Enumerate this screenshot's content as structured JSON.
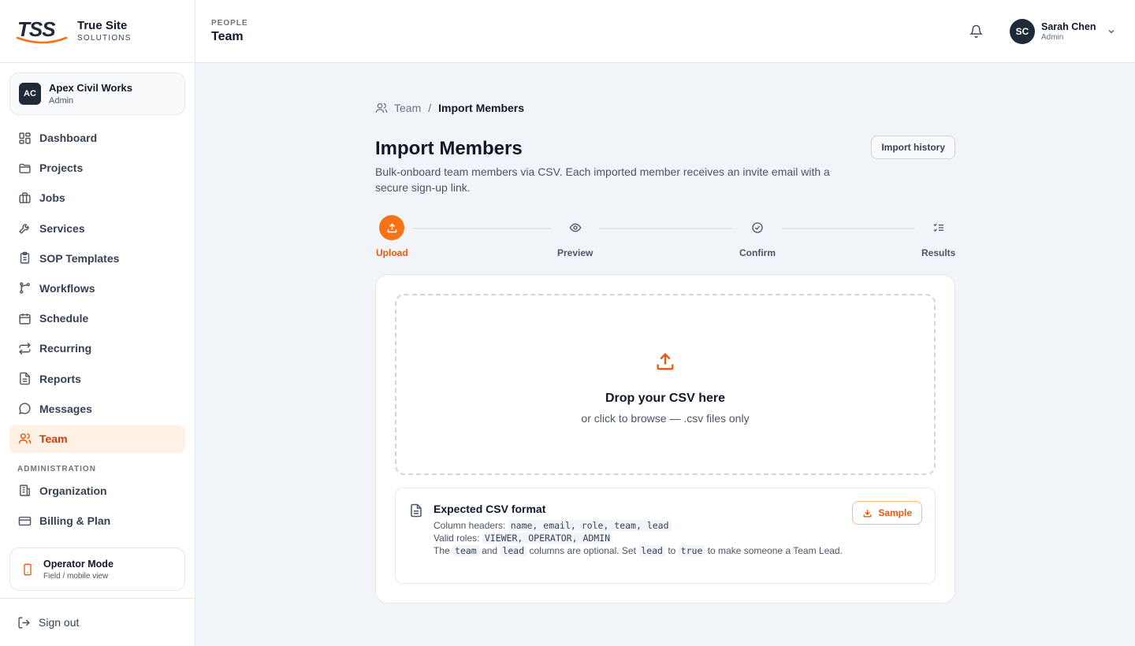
{
  "brand": {
    "mark": "TSS",
    "name": "True Site",
    "tagline": "SOLUTIONS",
    "accent": "#f97316"
  },
  "org": {
    "initials": "AC",
    "name": "Apex Civil Works",
    "role": "Admin"
  },
  "nav": {
    "items": [
      {
        "label": "Dashboard",
        "icon": "dashboard-icon"
      },
      {
        "label": "Projects",
        "icon": "folder-icon"
      },
      {
        "label": "Jobs",
        "icon": "briefcase-icon"
      },
      {
        "label": "Services",
        "icon": "wrench-icon"
      },
      {
        "label": "SOP Templates",
        "icon": "clipboard-icon"
      },
      {
        "label": "Workflows",
        "icon": "workflow-icon"
      },
      {
        "label": "Schedule",
        "icon": "calendar-icon"
      },
      {
        "label": "Recurring",
        "icon": "repeat-icon"
      },
      {
        "label": "Reports",
        "icon": "file-text-icon"
      },
      {
        "label": "Messages",
        "icon": "message-icon"
      },
      {
        "label": "Team",
        "icon": "users-icon",
        "active": true
      }
    ],
    "admin_section": "ADMINISTRATION",
    "admin_items": [
      {
        "label": "Organization",
        "icon": "building-icon"
      },
      {
        "label": "Billing & Plan",
        "icon": "credit-card-icon"
      }
    ]
  },
  "operator_mode": {
    "title": "Operator Mode",
    "subtitle": "Field / mobile view"
  },
  "sign_out": "Sign out",
  "header": {
    "kicker": "PEOPLE",
    "title": "Team"
  },
  "user": {
    "initials": "SC",
    "name": "Sarah Chen",
    "role": "Admin"
  },
  "breadcrumb": {
    "parent": "Team",
    "separator": "/",
    "current": "Import Members"
  },
  "page": {
    "title": "Import Members",
    "description": "Bulk-onboard team members via CSV. Each imported member receives an invite email with a secure sign-up link.",
    "history_button": "Import history"
  },
  "steps": [
    {
      "label": "Upload",
      "active": true
    },
    {
      "label": "Preview"
    },
    {
      "label": "Confirm"
    },
    {
      "label": "Results"
    }
  ],
  "dropzone": {
    "title": "Drop your CSV here",
    "subtitle": "or click to browse — .csv files only"
  },
  "format": {
    "title": "Expected CSV format",
    "headers_label": "Column headers:",
    "headers_value": "name, email, role, team, lead",
    "roles_label": "Valid roles:",
    "roles_value": "VIEWER, OPERATOR, ADMIN",
    "note_prefix": "The",
    "note_team": "team",
    "note_and": "and",
    "note_lead": "lead",
    "note_mid": "columns are optional. Set",
    "note_lead2": "lead",
    "note_to": "to",
    "note_true": "true",
    "note_suffix": "to make someone a Team Lead.",
    "sample_button": "Sample"
  }
}
